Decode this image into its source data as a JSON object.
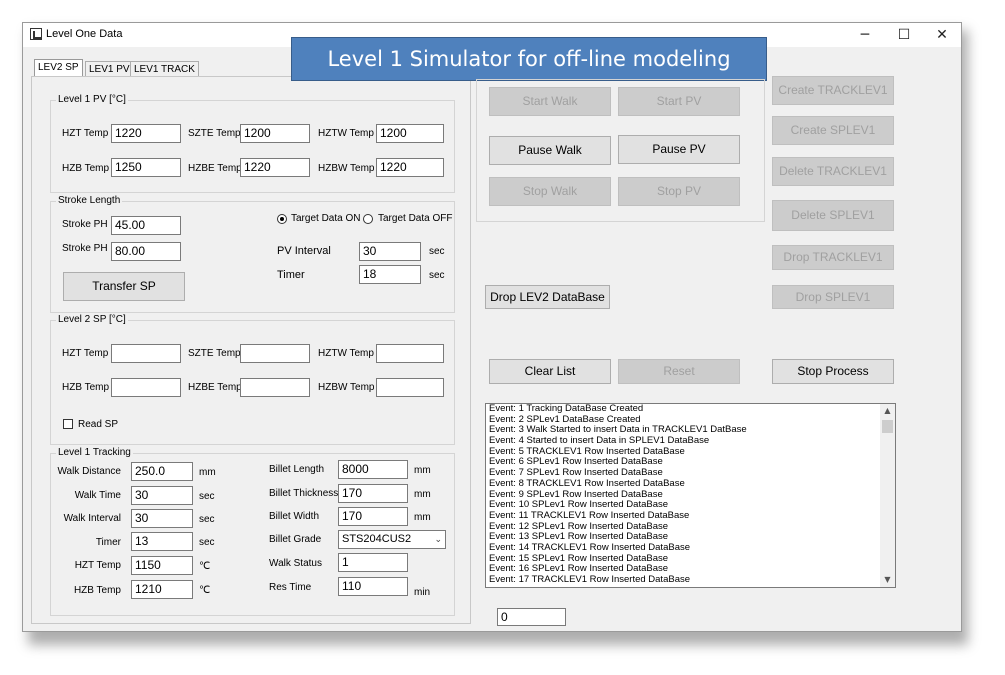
{
  "window": {
    "title": "Level One Data",
    "minimize": "─",
    "maximize": "☐",
    "close": "✕"
  },
  "banner": "Level 1  Simulator for off-line modeling",
  "tabs": [
    "LEV2 SP",
    "LEV1 PV",
    "LEV1 TRACK"
  ],
  "level1_pv": {
    "group_label": "Level 1 PV [°C]",
    "hzt_label": "HZT Temp",
    "hzt_value": "1220",
    "szte_label": "SZTE Temp",
    "szte_value": "1200",
    "hztw_label": "HZTW Temp",
    "hztw_value": "1200",
    "hzb_label": "HZB Temp",
    "hzb_value": "1250",
    "hzbe_label": "HZBE Temp",
    "hzbe_value": "1220",
    "hzbw_label": "HZBW Temp",
    "hzbw_value": "1220"
  },
  "stroke": {
    "group_label": "Stroke Length",
    "ph1_label": "Stroke PH",
    "ph1_value": "45.00",
    "ph2_label": "Stroke PH",
    "ph2_value": "80.00",
    "target_on_label": "Target Data ON",
    "target_off_label": "Target Data OFF",
    "target_selected": "on",
    "pv_interval_label": "PV Interval",
    "pv_interval_value": "30",
    "pv_interval_unit": "sec",
    "timer_label": "Timer",
    "timer_value": "18",
    "timer_unit": "sec",
    "transfer_button": "Transfer SP"
  },
  "level2_sp": {
    "group_label": "Level 2 SP [°C]",
    "hzt_label": "HZT Temp",
    "hzt_value": "",
    "szte_label": "SZTE Temp",
    "szte_value": "",
    "hztw_label": "HZTW Temp",
    "hztw_value": "",
    "hzb_label": "HZB Temp",
    "hzb_value": "",
    "hzbe_label": "HZBE Temp",
    "hzbe_value": "",
    "hzbw_label": "HZBW Temp",
    "hzbw_value": "",
    "read_sp_label": "Read SP",
    "read_sp_checked": false
  },
  "tracking": {
    "group_label": "Level 1 Tracking",
    "walk_distance_label": "Walk Distance",
    "walk_distance_value": "250.0",
    "walk_distance_unit": "mm",
    "walk_time_label": "Walk Time",
    "walk_time_value": "30",
    "walk_time_unit": "sec",
    "walk_interval_label": "Walk Interval",
    "walk_interval_value": "30",
    "walk_interval_unit": "sec",
    "timer_label": "Timer",
    "timer_value": "13",
    "timer_unit": "sec",
    "hzt_label": "HZT Temp",
    "hzt_value": "1150",
    "hzt_unit": "℃",
    "hzb_label": "HZB Temp",
    "hzb_value": "1210",
    "hzb_unit": "℃",
    "billet_length_label": "Billet Length",
    "billet_length_value": "8000",
    "billet_length_unit": "mm",
    "billet_thickness_label": "Billet Thickness",
    "billet_thickness_value": "170",
    "billet_thickness_unit": "mm",
    "billet_width_label": "Billet Width",
    "billet_width_value": "170",
    "billet_width_unit": "mm",
    "billet_grade_label": "Billet Grade",
    "billet_grade_value": "STS204CUS2",
    "walk_status_label": "Walk Status",
    "walk_status_value": "1",
    "res_time_label": "Res Time",
    "res_time_value": "110",
    "res_time_unit": "min"
  },
  "controls": {
    "start_walk": "Start Walk",
    "start_pv": "Start PV",
    "pause_walk": "Pause Walk",
    "pause_pv": "Pause PV",
    "stop_walk": "Stop Walk",
    "stop_pv": "Stop PV",
    "drop_lev2": "Drop LEV2 DataBase",
    "clear_list": "Clear List",
    "reset": "Reset",
    "stop_process": "Stop Process"
  },
  "db_buttons": {
    "create_track": "Create TRACKLEV1",
    "create_sp": "Create SPLEV1",
    "delete_track": "Delete TRACKLEV1",
    "delete_sp": "Delete SPLEV1",
    "drop_track": "Drop TRACKLEV1",
    "drop_sp": "Drop SPLEV1"
  },
  "event_log": [
    "Event: 1 Tracking DataBase Created",
    "Event: 2 SPLev1 DataBase Created",
    "Event: 3 Walk Started to insert Data in TRACKLEV1 DatBase",
    "Event: 4 Started to insert Data in SPLEV1 DataBase",
    "Event: 5 TRACKLEV1 Row Inserted DataBase",
    "Event: 6 SPLev1 Row Inserted DataBase",
    "Event: 7 SPLev1 Row Inserted DataBase",
    "Event: 8 TRACKLEV1 Row Inserted DataBase",
    "Event: 9 SPLev1 Row Inserted DataBase",
    "Event: 10 SPLev1 Row Inserted DataBase",
    "Event: 11 TRACKLEV1 Row Inserted DataBase",
    "Event: 12 SPLev1 Row Inserted DataBase",
    "Event: 13 SPLev1 Row Inserted DataBase",
    "Event: 14 TRACKLEV1 Row Inserted DataBase",
    "Event: 15 SPLev1 Row Inserted DataBase",
    "Event: 16 SPLev1 Row Inserted DataBase",
    "Event: 17 TRACKLEV1 Row Inserted DataBase"
  ],
  "counter_value": "0",
  "icons": {
    "app": "app-window-icon",
    "scroll_up": "▲",
    "scroll_down": "▼",
    "combo_arrow": "⌄"
  },
  "colors": {
    "banner": "#4f81bd",
    "window_bg": "#f0f0f0",
    "disabled_button": "#cccccc"
  }
}
